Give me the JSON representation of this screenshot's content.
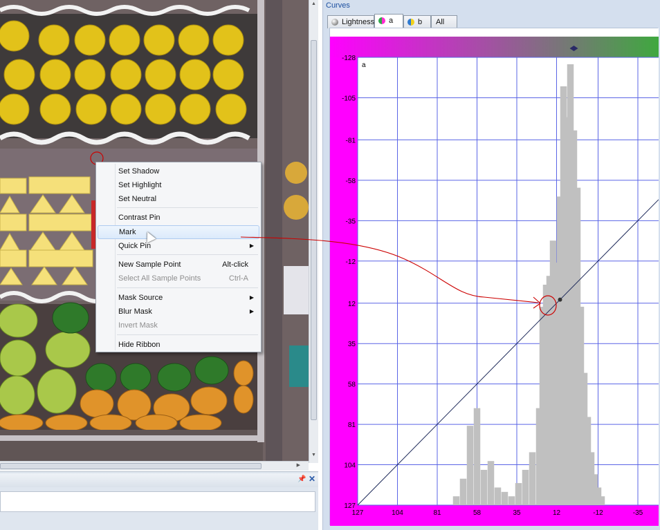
{
  "context_menu": {
    "items": [
      {
        "label": "Set Shadow",
        "shortcut": "",
        "submenu": false,
        "disabled": false,
        "highlight": false
      },
      {
        "label": "Set Highlight",
        "shortcut": "",
        "submenu": false,
        "disabled": false,
        "highlight": false
      },
      {
        "label": "Set Neutral",
        "shortcut": "",
        "submenu": false,
        "disabled": false,
        "highlight": false
      },
      {
        "label": "Contrast Pin",
        "shortcut": "",
        "submenu": false,
        "disabled": false,
        "highlight": false
      },
      {
        "label": "Mark",
        "shortcut": "",
        "submenu": false,
        "disabled": false,
        "highlight": true
      },
      {
        "label": "Quick Pin",
        "shortcut": "",
        "submenu": true,
        "disabled": false,
        "highlight": false
      },
      {
        "label": "New Sample Point",
        "shortcut": "Alt-click",
        "submenu": false,
        "disabled": false,
        "highlight": false
      },
      {
        "label": "Select All Sample Points",
        "shortcut": "Ctrl-A",
        "submenu": false,
        "disabled": true,
        "highlight": false
      },
      {
        "label": "Mask Source",
        "shortcut": "",
        "submenu": true,
        "disabled": false,
        "highlight": false
      },
      {
        "label": "Blur Mask",
        "shortcut": "",
        "submenu": true,
        "disabled": false,
        "highlight": false
      },
      {
        "label": "Invert Mask",
        "shortcut": "",
        "submenu": false,
        "disabled": true,
        "highlight": false
      },
      {
        "label": "Hide Ribbon",
        "shortcut": "",
        "submenu": false,
        "disabled": false,
        "highlight": false
      }
    ]
  },
  "curves_panel": {
    "title": "Curves",
    "tabs": [
      {
        "label": "Lightness",
        "icon": "lightness-channel-icon",
        "active": false
      },
      {
        "label": "a",
        "icon": "a-channel-icon",
        "active": true
      },
      {
        "label": "b",
        "icon": "b-channel-icon",
        "active": false
      },
      {
        "label": "All",
        "icon": "",
        "active": false
      }
    ],
    "channel_label": "a"
  },
  "bottom_panel": {
    "pin_icon": "pin-icon",
    "close_icon": "close-icon"
  },
  "colors": {
    "magenta": "#ff00ff",
    "green": "#3fa83f",
    "grid": "#5a64e6",
    "histogram": "#c0c0c0",
    "curve": "#1e2a5a",
    "annotation": "#cc0000"
  },
  "chart_data": {
    "type": "line",
    "title": "",
    "x_ticks": [
      127,
      104,
      81,
      58,
      35,
      12,
      -12,
      -35
    ],
    "y_ticks": [
      -128,
      -105,
      -81,
      -58,
      -35,
      -12,
      12,
      35,
      58,
      81,
      104,
      127
    ],
    "xlim": [
      127,
      -47
    ],
    "ylim": [
      -128,
      127
    ],
    "curve": {
      "x": [
        127,
        -47
      ],
      "y": [
        127,
        -47
      ]
    },
    "mark_point": {
      "x": 10,
      "y": 10
    },
    "histogram": {
      "x": [
        70,
        66,
        62,
        58,
        54,
        50,
        46,
        42,
        38,
        34,
        30,
        26,
        22,
        20,
        18,
        16,
        14,
        12,
        10,
        8,
        6,
        4,
        2,
        0,
        -2,
        -4,
        -6,
        -8,
        -10,
        -12,
        -14
      ],
      "counts": [
        0.02,
        0.06,
        0.18,
        0.22,
        0.08,
        0.1,
        0.04,
        0.03,
        0.02,
        0.05,
        0.08,
        0.12,
        0.22,
        0.45,
        0.5,
        0.52,
        0.6,
        0.55,
        0.7,
        0.95,
        0.88,
        1.0,
        0.85,
        0.72,
        0.45,
        0.3,
        0.2,
        0.12,
        0.07,
        0.04,
        0.02
      ]
    }
  }
}
